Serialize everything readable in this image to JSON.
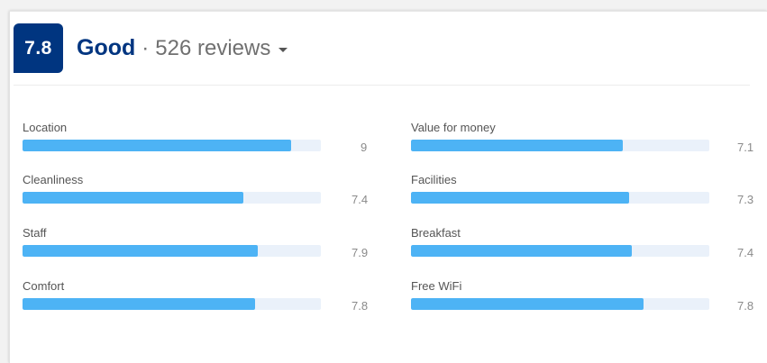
{
  "summary": {
    "score": "7.8",
    "verdict": "Good",
    "separator": "·",
    "review_count": "526 reviews"
  },
  "colors": {
    "badge": "#003580",
    "bar_fill": "#4db3f5",
    "bar_track": "#eaf1fa"
  },
  "categories": [
    {
      "label": "Location",
      "score": "9",
      "value": 9
    },
    {
      "label": "Cleanliness",
      "score": "7.4",
      "value": 7.4
    },
    {
      "label": "Staff",
      "score": "7.9",
      "value": 7.9
    },
    {
      "label": "Comfort",
      "score": "7.8",
      "value": 7.8
    },
    {
      "label": "Value for money",
      "score": "7.1",
      "value": 7.1
    },
    {
      "label": "Facilities",
      "score": "7.3",
      "value": 7.3
    },
    {
      "label": "Breakfast",
      "score": "7.4",
      "value": 7.4
    },
    {
      "label": "Free WiFi",
      "score": "7.8",
      "value": 7.8
    }
  ],
  "max_score": 10
}
